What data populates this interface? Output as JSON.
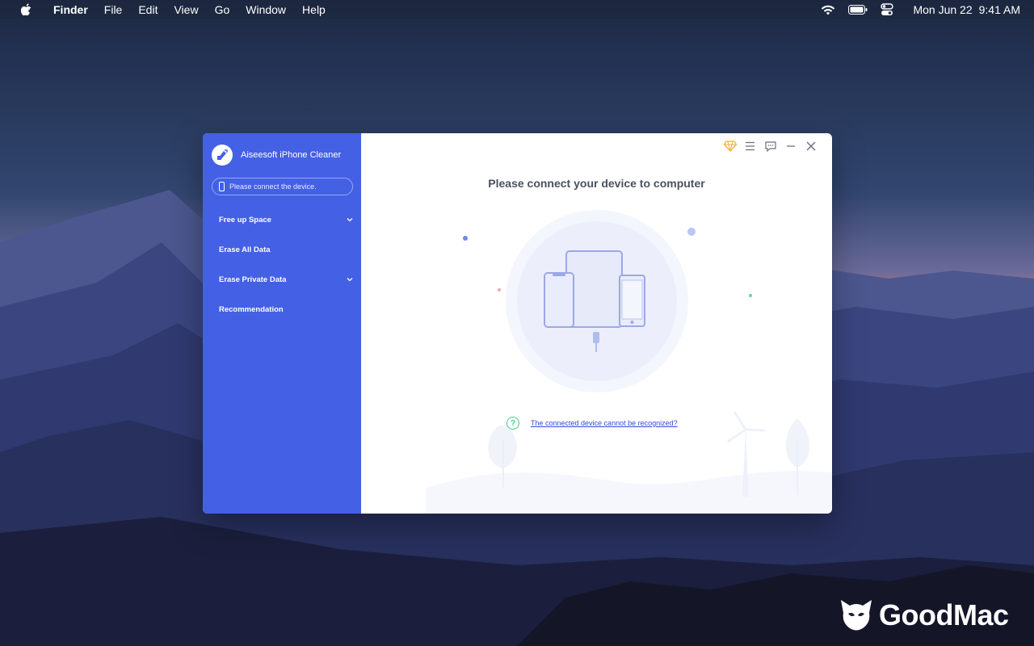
{
  "menubar": {
    "app_name": "Finder",
    "items": [
      "File",
      "Edit",
      "View",
      "Go",
      "Window",
      "Help"
    ],
    "date": "Mon Jun 22",
    "time": "9:41 AM"
  },
  "app": {
    "title": "Aiseesoft iPhone Cleaner",
    "device_status": "Please connect the device.",
    "nav": {
      "free_up_space": "Free up Space",
      "erase_all": "Erase All Data",
      "erase_private": "Erase Private Data",
      "recommendation": "Recommendation"
    },
    "main_title": "Please connect your device to computer",
    "help_link": "The connected device cannot be recognized?",
    "colors": {
      "sidebar": "#4460e4",
      "accent": "#3ccf8e",
      "link": "#2f4cd8"
    }
  },
  "watermark": {
    "brand": "GoodMac"
  }
}
